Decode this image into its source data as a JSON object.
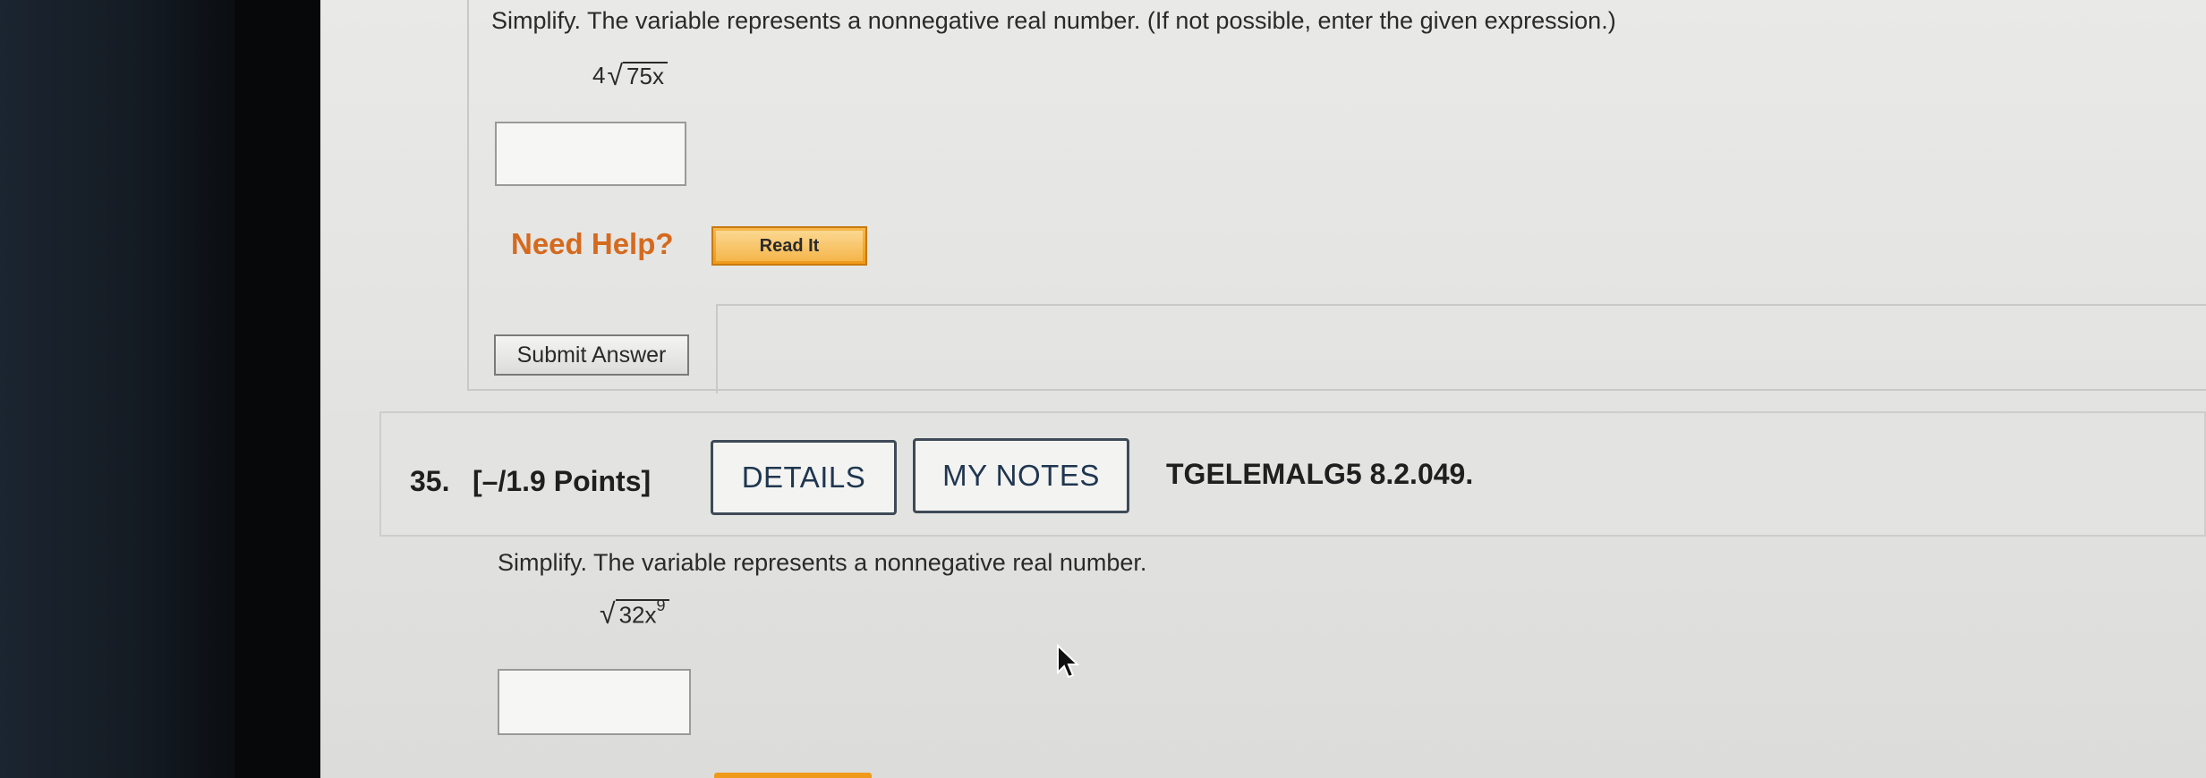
{
  "question_34": {
    "prompt": "Simplify. The variable represents a nonnegative real number. (If not possible, enter the given expression.)",
    "expression": {
      "coefficient": "4",
      "radicand": "75x"
    },
    "answer_value": "",
    "need_help_label": "Need Help?",
    "read_it_label": "Read It",
    "submit_label": "Submit Answer"
  },
  "question_35": {
    "number": "35.",
    "points": "[–/1.9 Points]",
    "details_label": "DETAILS",
    "my_notes_label": "MY NOTES",
    "code": "TGELEMALG5 8.2.049.",
    "prompt": "Simplify. The variable represents a nonnegative real number.",
    "expression": {
      "radicand_base": "32x",
      "exponent": "9"
    },
    "answer_value": ""
  },
  "icons": {
    "radical": "square-root-icon",
    "cursor": "mouse-pointer-icon"
  },
  "colors": {
    "need_help": "#d56a1e",
    "read_it": "#ef9a1a",
    "button_text": "#1f3650"
  }
}
